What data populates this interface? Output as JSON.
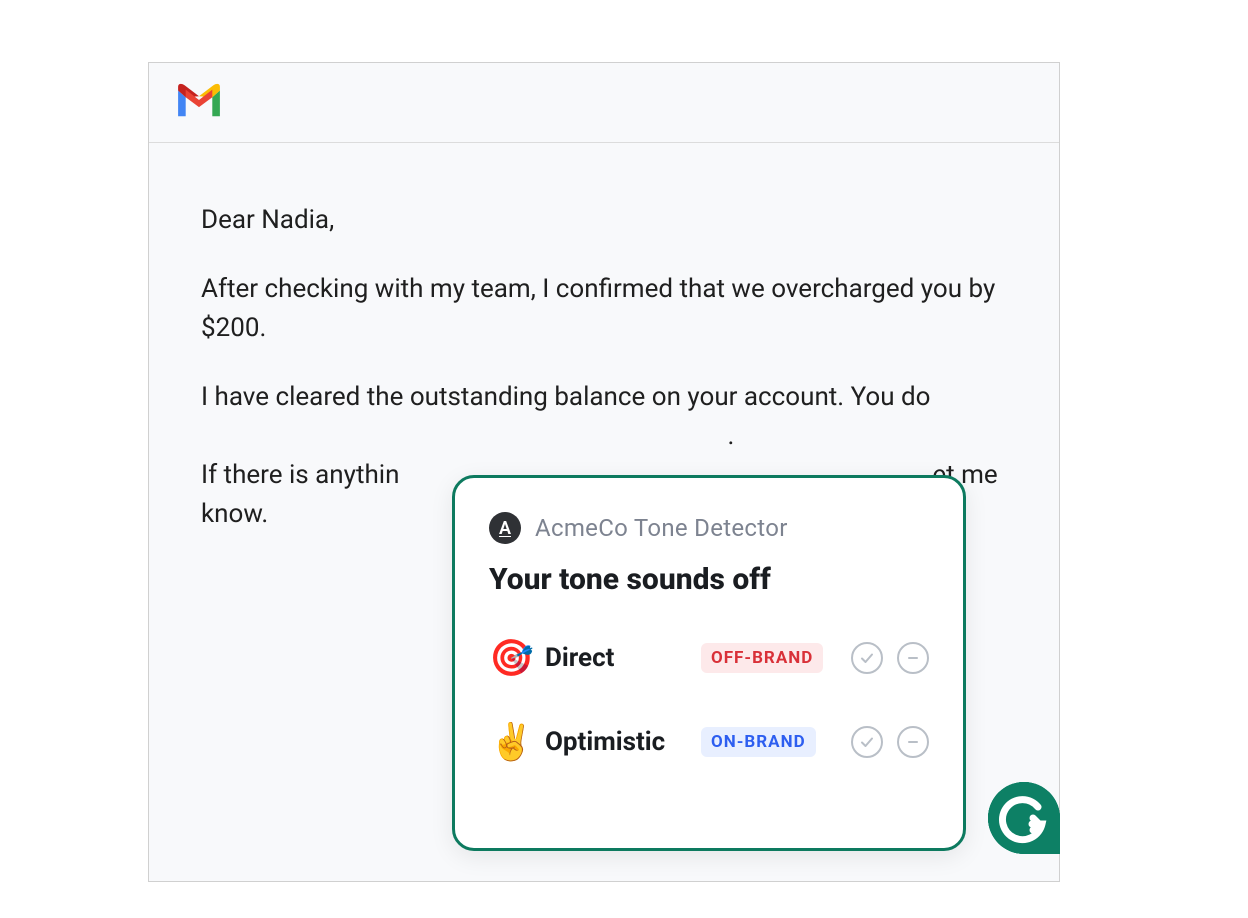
{
  "email": {
    "greeting": "Dear Nadia,",
    "para1": "After checking with my team, I confirmed that we overcharged you by $200.",
    "para2": "I have cleared the outstanding balance on your account. You do",
    "para2_cont": ".",
    "para3a": "If there is anythin",
    "para3b": "et me know."
  },
  "tone": {
    "brand_letter": "A",
    "brand_name": "AcmeCo Tone Detector",
    "title": "Your tone sounds off",
    "row1": {
      "emoji": "🎯",
      "label": "Direct",
      "badge": "OFF-BRAND"
    },
    "row2": {
      "emoji": "✌️",
      "label": "Optimistic",
      "badge": "ON-BRAND"
    }
  }
}
